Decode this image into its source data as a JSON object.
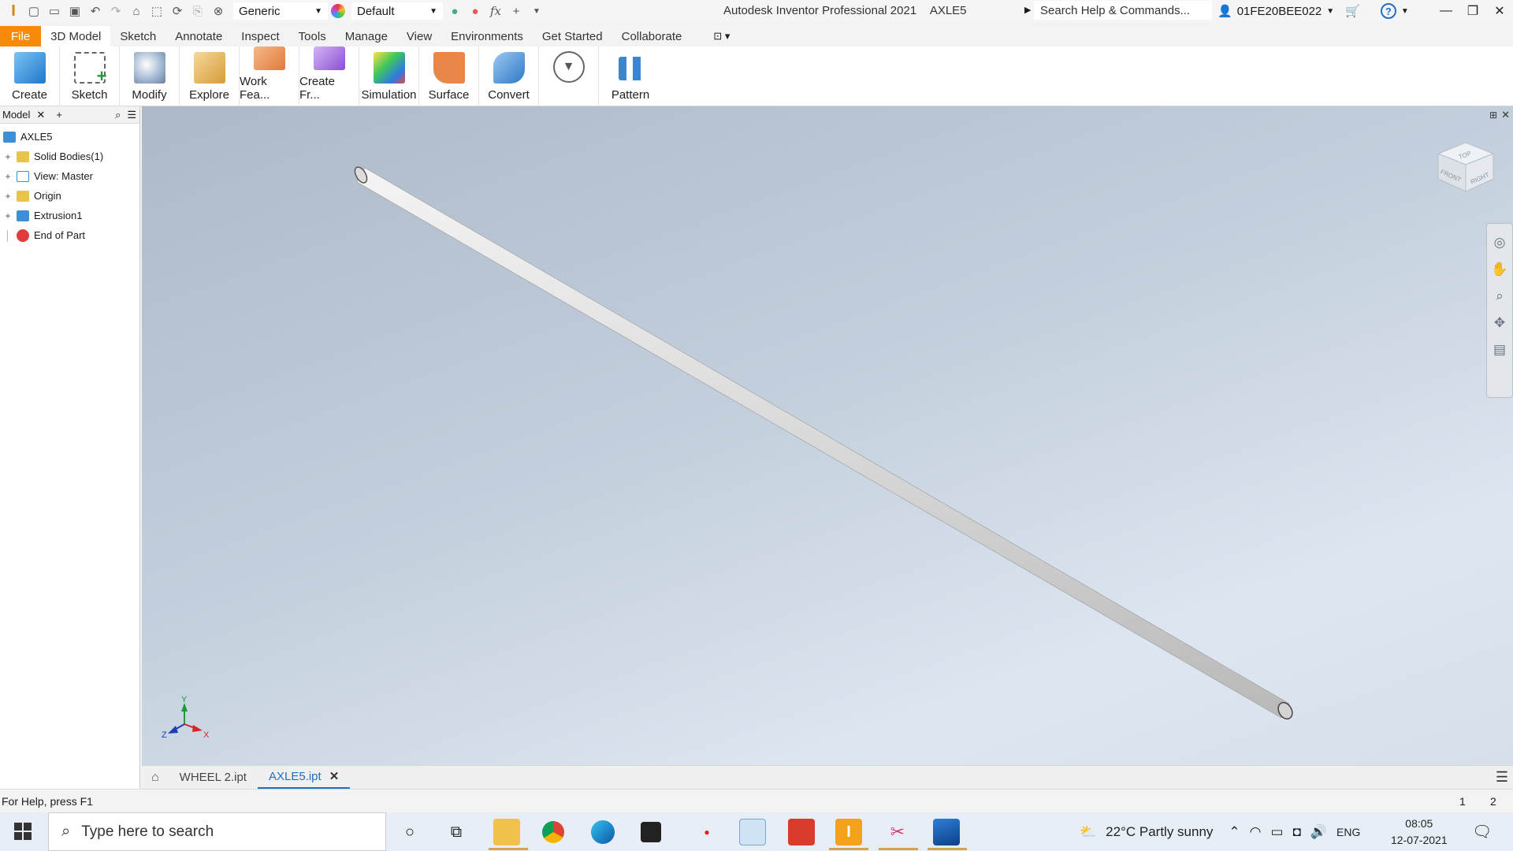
{
  "titlebar": {
    "app_title": "Autodesk Inventor Professional 2021",
    "document_name": "AXLE5",
    "material": "Generic",
    "appearance": "Default",
    "search_placeholder": "Search Help & Commands...",
    "user": "01FE20BEE022",
    "fx_label": "fx"
  },
  "menu": {
    "items": [
      "File",
      "3D Model",
      "Sketch",
      "Annotate",
      "Inspect",
      "Tools",
      "Manage",
      "View",
      "Environments",
      "Get Started",
      "Collaborate"
    ]
  },
  "ribbon": {
    "buttons": [
      "Create",
      "Sketch",
      "Modify",
      "Explore",
      "Work Fea...",
      "Create Fr...",
      "Simulation",
      "Surface",
      "Convert",
      "Pattern"
    ]
  },
  "browser": {
    "tab_label": "Model",
    "root": "AXLE5",
    "nodes": [
      "Solid Bodies(1)",
      "View: Master",
      "Origin",
      "Extrusion1",
      "End of Part"
    ]
  },
  "viewcube": {
    "top": "TOP",
    "front": "FRONT",
    "right": "RIGHT"
  },
  "axis": {
    "x": "X",
    "y": "Y",
    "z": "Z"
  },
  "document_tabs": [
    "WHEEL 2.ipt",
    "AXLE5.ipt"
  ],
  "status": {
    "help": "For Help, press F1",
    "num1": "1",
    "num2": "2"
  },
  "taskbar": {
    "search_placeholder": "Type here to search",
    "weather": "22°C  Partly sunny",
    "language": "ENG",
    "time": "08:05",
    "date": "12-07-2021"
  },
  "colors": {
    "file_tab": "#f58a0b",
    "active_tab": "#1f6fc2",
    "viewport_top": "#aeb9c8",
    "viewport_bottom": "#dde6f1"
  }
}
